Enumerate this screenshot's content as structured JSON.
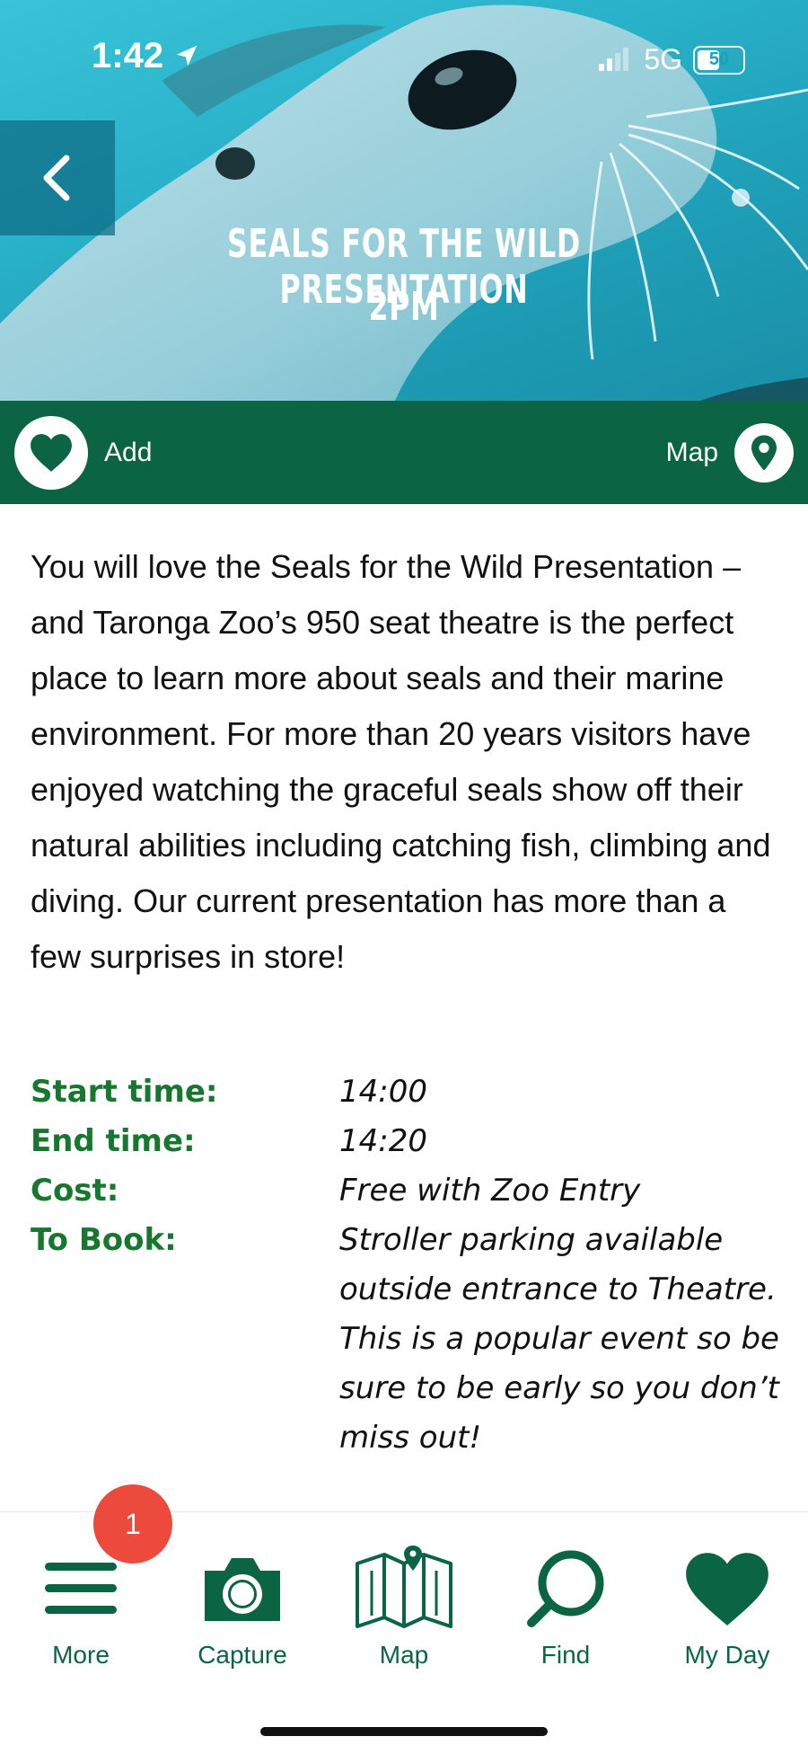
{
  "status_bar": {
    "time": "1:42",
    "network": "5G",
    "battery": "50"
  },
  "hero": {
    "title_line1": "SEALS FOR THE WILD PRESENTATION",
    "title_line2": "2PM"
  },
  "actions": {
    "add_label": "Add",
    "map_label": "Map"
  },
  "description": "You will love the Seals for the Wild Presentation – and Taronga Zoo’s 950 seat theatre is the perfect place to learn more about seals and their marine environment. For more than 20 years visitors have enjoyed watching the graceful seals show off their natural abilities including catching fish, climbing and diving. Our current presentation has more than a few surprises in store!",
  "details": [
    {
      "label": "Start time:",
      "value": "14:00"
    },
    {
      "label": "End time:",
      "value": "14:20"
    },
    {
      "label": "Cost:",
      "value": "Free with Zoo Entry"
    },
    {
      "label": "To Book:",
      "value": "Stroller parking available outside entrance to Theatre. This is a popular event so be sure to be early so you don’t miss out!"
    }
  ],
  "tabbar": {
    "badge_count": "1",
    "tabs": [
      {
        "label": "More",
        "icon": "menu-icon"
      },
      {
        "label": "Capture",
        "icon": "camera-icon"
      },
      {
        "label": "Map",
        "icon": "folded-map-icon"
      },
      {
        "label": "Find",
        "icon": "search-icon"
      },
      {
        "label": "My Day",
        "icon": "heart-icon"
      }
    ]
  },
  "colors": {
    "brand_green": "#0b6444",
    "label_green": "#17772f",
    "badge_red": "#ec4a3c"
  }
}
